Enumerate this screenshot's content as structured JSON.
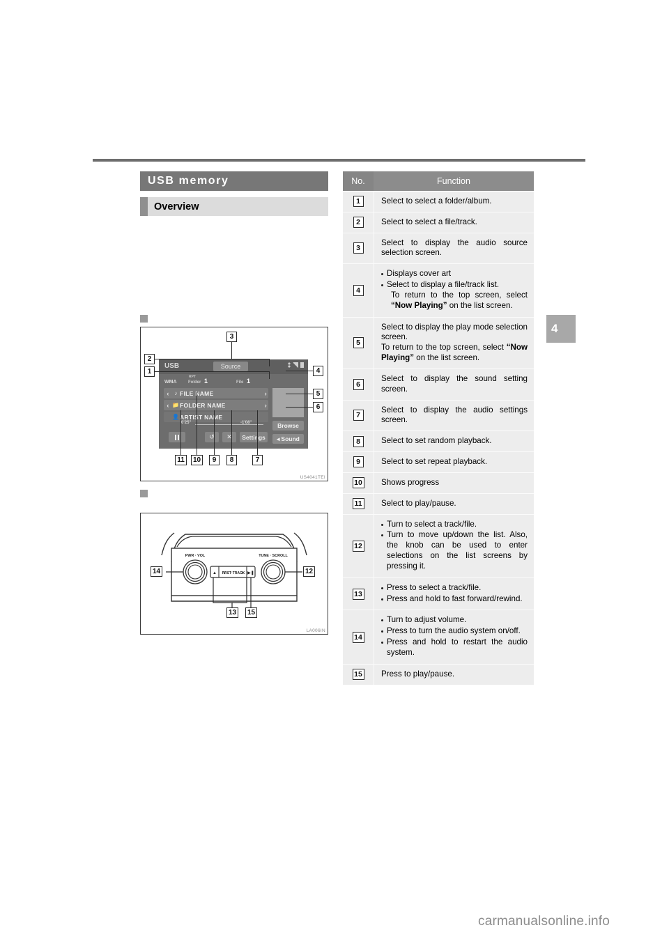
{
  "section": {
    "title": "USB memory",
    "subtitle": "Overview"
  },
  "chapter_tab": "4",
  "figures": {
    "screen": {
      "code": "US4041TEI",
      "header": {
        "source_label": "USB",
        "source_button": "Source",
        "status_icons": [
          "bluetooth-icon",
          "signal-icon",
          "battery-icon"
        ]
      },
      "meta": {
        "rpt": "RPT",
        "format": "WMA",
        "folder_label": "Folder",
        "folder_value": "1",
        "file_label": "File",
        "file_value": "1"
      },
      "rows": [
        {
          "icon": "music-note-icon",
          "text": "FILE NAME"
        },
        {
          "icon": "folder-icon",
          "text": "FOLDER NAME"
        },
        {
          "icon": "person-icon",
          "text": "ARTIST NAME"
        }
      ],
      "browse_button": "Browse",
      "sound_button": "Sound",
      "settings_button": "Settings",
      "time_elapsed": "0'25\"",
      "time_remaining": "-1'08\"",
      "callouts": [
        "1",
        "2",
        "3",
        "4",
        "5",
        "6",
        "7",
        "8",
        "9",
        "10",
        "11"
      ]
    },
    "hardware": {
      "code": "LA006IN",
      "labels": {
        "pwr_vol": "PWR · VOL",
        "tune_scroll": "TUNE · SCROLL",
        "prst_track": "PRST · TRACK"
      },
      "callouts": [
        "12",
        "13",
        "14",
        "15"
      ]
    }
  },
  "table": {
    "headers": {
      "no": "No.",
      "function": "Function"
    },
    "rows": [
      {
        "no": "1",
        "type": "text",
        "text": "Select to select a folder/album."
      },
      {
        "no": "2",
        "type": "text",
        "text": "Select to select a file/track."
      },
      {
        "no": "3",
        "type": "text",
        "text": "Select to display the audio source selection screen."
      },
      {
        "no": "4",
        "type": "bullets",
        "items": [
          {
            "text": "Displays cover art"
          },
          {
            "text": "Select to display a file/track list.",
            "sub_pre": "To return to the top screen, select ",
            "sub_bold": "“Now Playing”",
            "sub_post": " on the list screen."
          }
        ]
      },
      {
        "no": "5",
        "type": "paras",
        "paras": [
          {
            "text": "Select to display the play mode selection screen."
          },
          {
            "pre": "To return to the top screen, select ",
            "bold": "“Now Playing”",
            "post": " on the list screen."
          }
        ]
      },
      {
        "no": "6",
        "type": "text",
        "text": "Select to display the sound setting screen."
      },
      {
        "no": "7",
        "type": "text",
        "text": "Select to display the audio settings screen."
      },
      {
        "no": "8",
        "type": "text",
        "text": "Select to set random playback."
      },
      {
        "no": "9",
        "type": "text",
        "text": "Select to set repeat playback."
      },
      {
        "no": "10",
        "type": "text",
        "text": "Shows progress"
      },
      {
        "no": "11",
        "type": "text",
        "text": "Select to play/pause."
      },
      {
        "no": "12",
        "type": "bullets",
        "items": [
          {
            "text": "Turn to select a track/file."
          },
          {
            "text": "Turn to move up/down the list. Also, the knob can be used to enter selections on the list screens by pressing it."
          }
        ]
      },
      {
        "no": "13",
        "type": "bullets",
        "items": [
          {
            "text": "Press to select a track/file."
          },
          {
            "text": "Press and hold to fast forward/rewind."
          }
        ]
      },
      {
        "no": "14",
        "type": "bullets",
        "items": [
          {
            "text": "Turn to adjust volume."
          },
          {
            "text": "Press to turn the audio system on/off."
          },
          {
            "text": "Press and hold to restart the audio system."
          }
        ]
      },
      {
        "no": "15",
        "type": "text",
        "text": "Press to play/pause."
      }
    ]
  },
  "watermark": "carmanualsonline.info"
}
